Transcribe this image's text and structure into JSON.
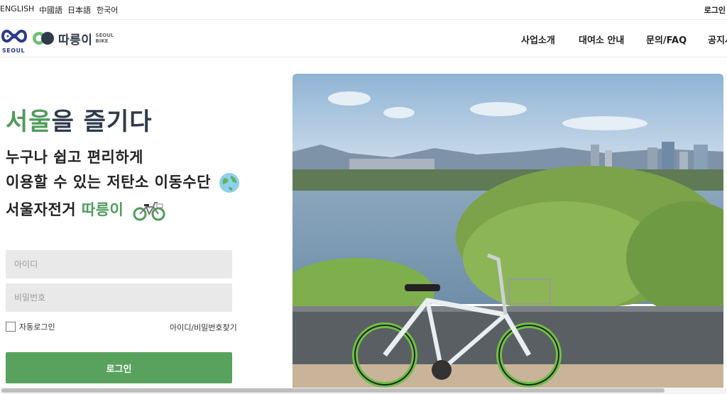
{
  "topbar": {
    "languages": [
      "ENGLISH",
      "中國語",
      "日本語",
      "한국어"
    ],
    "login": "로그인"
  },
  "brand": {
    "seoul_text": "SEOUL",
    "name": "따릉이",
    "sub1": "SEOUL",
    "sub2": "BIKE"
  },
  "nav": {
    "items": [
      "사업소개",
      "대여소 안내",
      "문의/FAQ",
      "공지사항"
    ]
  },
  "hero": {
    "title_green": "서울",
    "title_rest": "을 즐기다",
    "line1": "누구나 쉽고 편리하게",
    "line2": "이용할 수 있는 저탄소 이동수단",
    "line3_prefix": "서울자전거 ",
    "line3_green": "따릉이"
  },
  "form": {
    "id_placeholder": "아이디",
    "pw_placeholder": "비밀번호",
    "auto_login": "자동로그인",
    "find_link": "아이디/비밀번호찾기",
    "login_button": "로그인"
  },
  "icons": {
    "globe": "globe-icon",
    "bike": "bicycle-icon",
    "checkbox": "checkbox-icon"
  },
  "colors": {
    "brand_green": "#58a25e",
    "title_dark": "#2f3a4a",
    "seoul_blue": "#2c3a8c"
  }
}
